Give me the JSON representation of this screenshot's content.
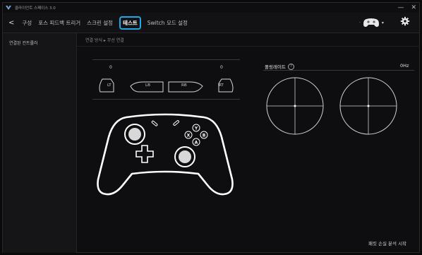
{
  "app": {
    "title": "클라이언트 스페이스 3.0"
  },
  "window": {
    "minimize": "—",
    "close": "✕"
  },
  "nav": {
    "back": "<",
    "items": [
      "구성",
      "포스 피드백 트리거",
      "스크린 설정",
      "테스트",
      "Switch 모드 설정"
    ],
    "active_index": 3
  },
  "device": {
    "dot": "·",
    "dropdown": "▾",
    "icon": "controller-icon"
  },
  "sidebar": {
    "items": [
      "연결된 컨트롤러"
    ]
  },
  "breadcrumb": "연결 방식 ▸ 무선 연결",
  "triggers": {
    "lt_value": "0",
    "rt_value": "0",
    "labels": [
      "LT",
      "LB",
      "RB",
      "RT"
    ]
  },
  "buttons": [
    "Y",
    "X",
    "B",
    "A"
  ],
  "polling": {
    "label": "폴링레이트",
    "value": "0Hz"
  },
  "footer": {
    "action": "패킷 손실 분석 시작"
  },
  "colors": {
    "accent": "#23a6e8",
    "background": "#0e0e10"
  }
}
